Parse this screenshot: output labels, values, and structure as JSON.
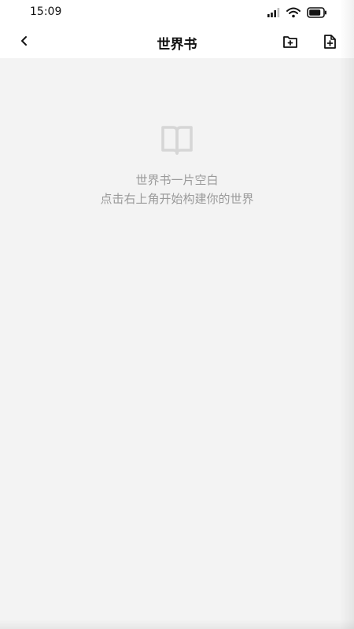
{
  "status_bar": {
    "time": "15:09",
    "icons": [
      "signal-icon",
      "wifi-icon",
      "battery-icon"
    ]
  },
  "header": {
    "title": "世界书",
    "back_icon": "chevron-left-icon",
    "actions": [
      "new-folder-icon",
      "new-file-icon"
    ]
  },
  "empty_state": {
    "icon": "book-open-icon",
    "line1": "世界书一片空白",
    "line2": "点击右上角开始构建你的世界"
  },
  "colors": {
    "background": "#f3f3f3",
    "header_bg": "#ffffff",
    "muted_text": "#9a9a9a",
    "icon_muted": "#d6d6d6"
  }
}
